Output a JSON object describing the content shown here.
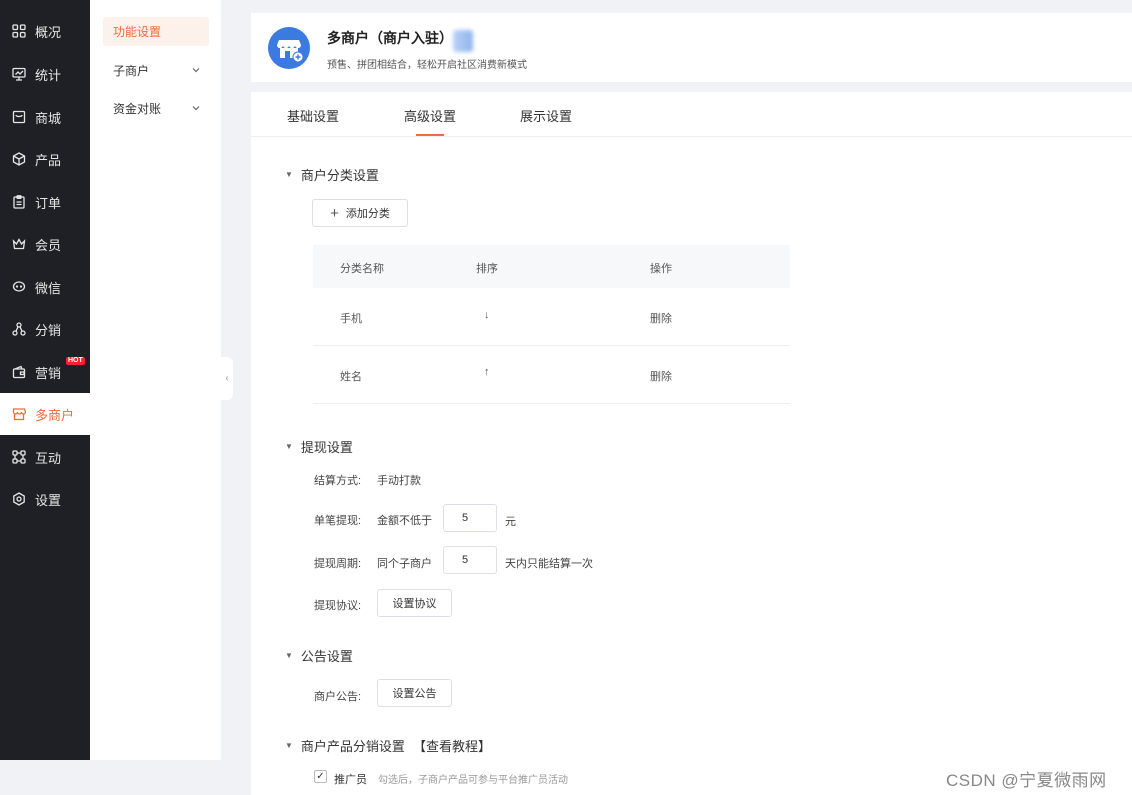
{
  "sidebar": {
    "items": [
      {
        "label": "概况",
        "icon": "grid-icon"
      },
      {
        "label": "统计",
        "icon": "monitor-chart-icon"
      },
      {
        "label": "商城",
        "icon": "shop-window-icon"
      },
      {
        "label": "产品",
        "icon": "cube-icon"
      },
      {
        "label": "订单",
        "icon": "clipboard-icon"
      },
      {
        "label": "会员",
        "icon": "crown-icon"
      },
      {
        "label": "微信",
        "icon": "chat-bubble-icon"
      },
      {
        "label": "分销",
        "icon": "network-icon"
      },
      {
        "label": "营销",
        "icon": "wallet-icon",
        "badge": "HOT"
      },
      {
        "label": "多商户",
        "icon": "storefront-icon",
        "active": true
      },
      {
        "label": "互动",
        "icon": "connect-icon"
      },
      {
        "label": "设置",
        "icon": "gear-icon"
      }
    ]
  },
  "submenu": {
    "items": [
      {
        "label": "功能设置",
        "active": true
      },
      {
        "label": "子商户",
        "expandable": true
      },
      {
        "label": "资金对账",
        "expandable": true
      }
    ]
  },
  "header": {
    "title": "多商户（商户入驻）",
    "description": "预售、拼团相结合，轻松开启社区消费新模式"
  },
  "tabs": [
    "基础设置",
    "高级设置",
    "展示设置"
  ],
  "active_tab": "高级设置",
  "category_section": {
    "title": "商户分类设置",
    "add_button": "添加分类",
    "columns": [
      "分类名称",
      "排序",
      "操作"
    ],
    "rows": [
      {
        "name": "手机",
        "sort": "↓",
        "action": "删除"
      },
      {
        "name": "姓名",
        "sort": "↑",
        "action": "删除"
      }
    ]
  },
  "withdraw_section": {
    "title": "提现设置",
    "settle_label": "结算方式:",
    "settle_value": "手动打款",
    "single_label": "单笔提现:",
    "single_prefix": "金额不低于",
    "single_amount": "5",
    "single_unit": "元",
    "period_label": "提现周期:",
    "period_prefix": "同个子商户",
    "period_days": "5",
    "period_suffix": "天内只能结算一次",
    "agreement_label": "提现协议:",
    "agreement_button": "设置协议"
  },
  "notice_section": {
    "title": "公告设置",
    "notice_label": "商户公告:",
    "notice_button": "设置公告"
  },
  "distribution_section": {
    "title": "商户产品分销设置",
    "tutorial_link": "【查看教程】",
    "promoter_label": "推广员",
    "promoter_checked": true,
    "promoter_hint": "勾选后，子商户产品可参与平台推广员活动"
  },
  "watermark": "CSDN @宁夏微雨网",
  "colors": {
    "accent": "#f06a3c",
    "sidebar_bg": "#1f2025",
    "logo_blue": "#3b7be0",
    "hot_badge": "#f5222d"
  }
}
